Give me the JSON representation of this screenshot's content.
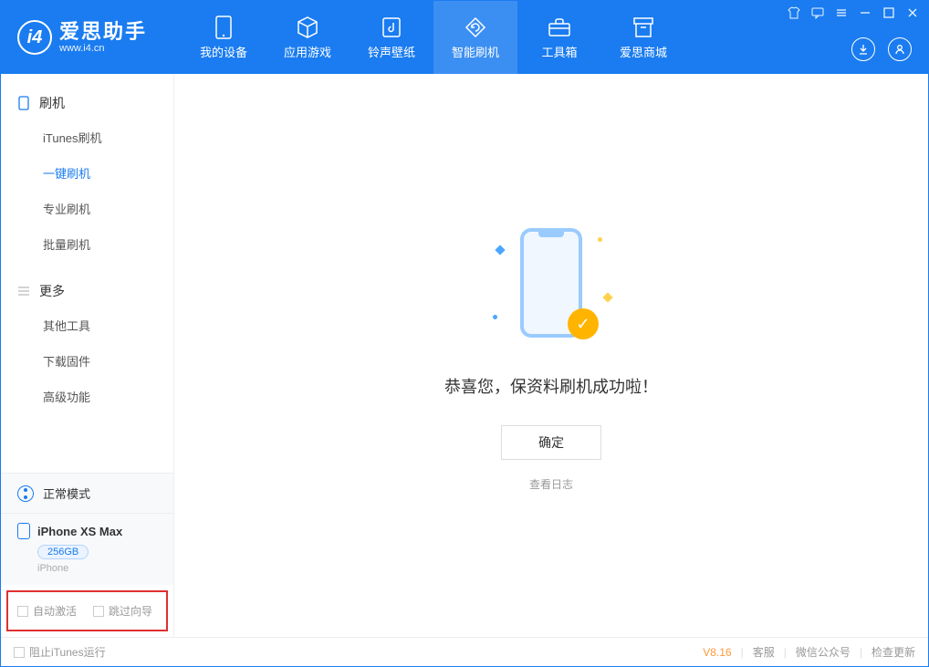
{
  "app": {
    "logo_initial": "i4",
    "name": "爱思助手",
    "url": "www.i4.cn"
  },
  "nav": [
    {
      "label": "我的设备",
      "icon": "device"
    },
    {
      "label": "应用游戏",
      "icon": "cube"
    },
    {
      "label": "铃声壁纸",
      "icon": "music"
    },
    {
      "label": "智能刷机",
      "icon": "refresh",
      "active": true
    },
    {
      "label": "工具箱",
      "icon": "toolbox"
    },
    {
      "label": "爱思商城",
      "icon": "shop"
    }
  ],
  "sidebar": {
    "groups": [
      {
        "title": "刷机",
        "icon": "phone",
        "items": [
          {
            "label": "iTunes刷机"
          },
          {
            "label": "一键刷机",
            "active": true
          },
          {
            "label": "专业刷机"
          },
          {
            "label": "批量刷机"
          }
        ]
      },
      {
        "title": "更多",
        "icon": "menu",
        "items": [
          {
            "label": "其他工具"
          },
          {
            "label": "下载固件"
          },
          {
            "label": "高级功能"
          }
        ]
      }
    ],
    "mode_label": "正常模式",
    "device": {
      "name": "iPhone XS Max",
      "storage": "256GB",
      "type": "iPhone"
    },
    "checkboxes": {
      "auto_activate": "自动激活",
      "skip_guide": "跳过向导"
    }
  },
  "main": {
    "success_text": "恭喜您，保资料刷机成功啦！",
    "ok_button": "确定",
    "view_log": "查看日志"
  },
  "statusbar": {
    "block_itunes": "阻止iTunes运行",
    "version": "V8.16",
    "links": [
      "客服",
      "微信公众号",
      "检查更新"
    ]
  }
}
